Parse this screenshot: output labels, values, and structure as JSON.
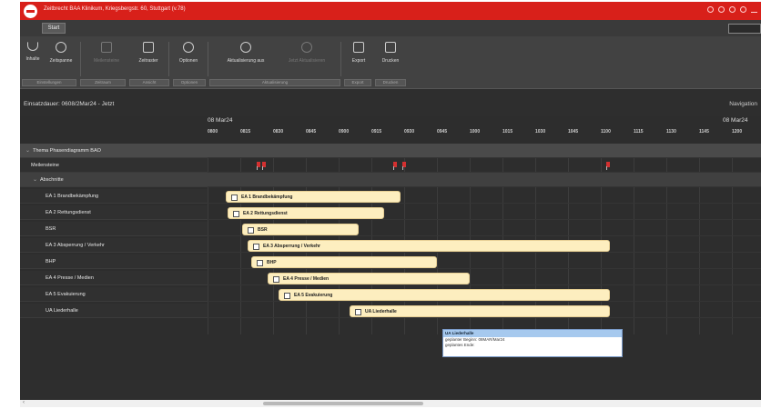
{
  "window": {
    "title": "Zeitbrecht BAA Klinikum, Kriegsbergstr. 60, Stuttgart (v.78)",
    "tab": "Start"
  },
  "ribbon": {
    "buttons": [
      {
        "label": "Inhalte",
        "icon": "funnel-icon",
        "enabled": true
      },
      {
        "label": "Zeitspanne",
        "icon": "clock-icon",
        "enabled": true
      },
      {
        "label": "Meilensteine",
        "icon": "milestone-icon",
        "enabled": false
      },
      {
        "label": "Zeitraster",
        "icon": "calendar-icon",
        "enabled": true
      },
      {
        "label": "Optionen",
        "icon": "options-icon",
        "enabled": true
      },
      {
        "label": "Aktualisierung aus",
        "icon": "refresh-icon",
        "enabled": true
      },
      {
        "label": "Jetzt Aktualisieren",
        "icon": "refresh-now-icon",
        "enabled": false
      },
      {
        "label": "Export",
        "icon": "export-icon",
        "enabled": true
      },
      {
        "label": "Drucken",
        "icon": "print-icon",
        "enabled": true
      }
    ],
    "groups": [
      "Einstellungen",
      "Zeitraum",
      "Ansicht",
      "Optionen",
      "Aktualisierung",
      "Export",
      "Drucken"
    ]
  },
  "status": {
    "duration": "Einsatzdauer: 0608/2Mar24 - Jetzt",
    "navigation": "Navigation"
  },
  "timeline": {
    "date_start": "08 Mar24",
    "date_end": "08 Mar24",
    "ticks": [
      "0800",
      "0815",
      "0830",
      "0845",
      "0900",
      "0915",
      "0930",
      "0945",
      "1000",
      "1015",
      "1030",
      "1045",
      "1100",
      "1115",
      "1130",
      "1145",
      "1200"
    ]
  },
  "rows": [
    {
      "label": "Thema Phasendiagramm BAO",
      "type": "group"
    },
    {
      "label": "Meilensteine",
      "type": "milestones"
    },
    {
      "label": "Abschnitte",
      "type": "sub"
    },
    {
      "label": "EA 1 Brandbekämpfung",
      "bar": "EA 1 Brandbekämpfung"
    },
    {
      "label": "EA 2 Rettungsdienst",
      "bar": "EA 2 Rettungsdienst"
    },
    {
      "label": "BSR",
      "bar": "BSR"
    },
    {
      "label": "EA 3 Absperrung / Verkehr",
      "bar": "EA 3 Absperrung / Verkehr"
    },
    {
      "label": "BHP",
      "bar": "BHP"
    },
    {
      "label": "EA 4 Presse / Medien",
      "bar": "EA 4 Presse / Medien"
    },
    {
      "label": "EA 5 Evakuierung",
      "bar": "EA 5 Evakuierung"
    },
    {
      "label": "UA Liederhalle",
      "bar": "UA Liederhalle"
    }
  ],
  "tooltip": {
    "title": "UA Liederhalle",
    "line1": "geplanter Beginn: 08MAR/Mar24",
    "line2": "geplantes Ende:"
  },
  "colors": {
    "titlebar": "#d8201a",
    "bar_fill": "#fdeebf",
    "milestone": "#d43030",
    "tooltip_header": "#a6c9ee"
  }
}
